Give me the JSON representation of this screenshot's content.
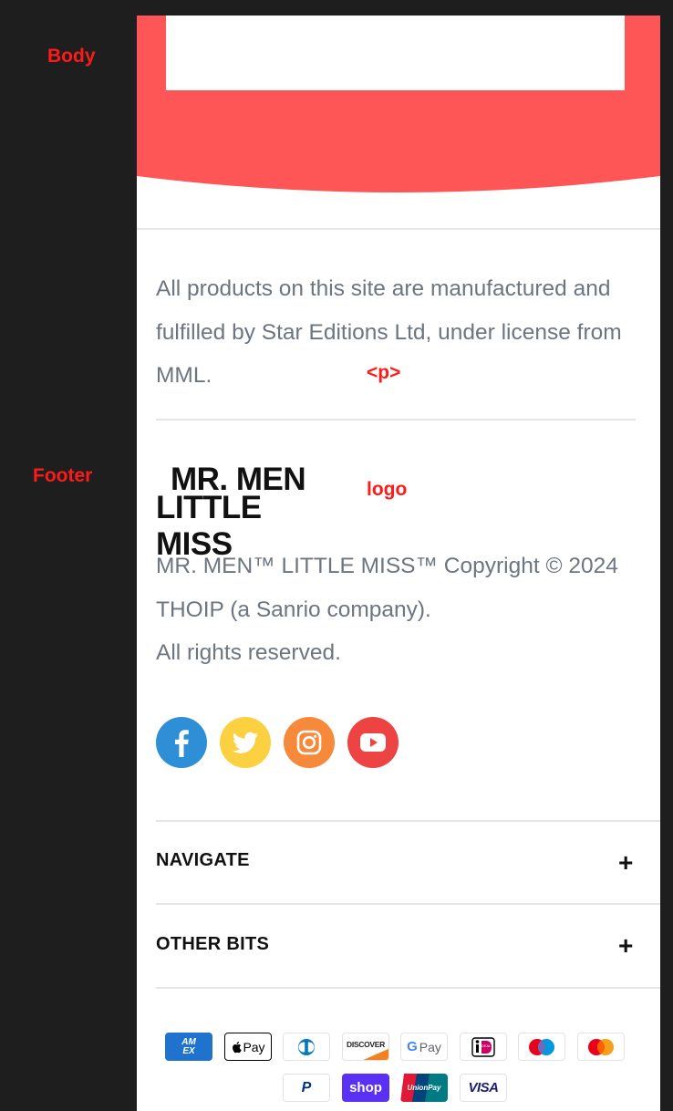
{
  "annotations": {
    "body": "Body",
    "footer": "Footer",
    "p_tag": "<p>",
    "logo": "logo"
  },
  "license_text": "All products on this site are manufactured and fulfilled by Star Editions Ltd, under license from MML.",
  "logo": {
    "line1": "MR. MEN",
    "line2": "LITTLE MISS"
  },
  "copyright": {
    "line1": "MR. MEN™ LITTLE MISS™ Copyright © 2024",
    "line2": "THOIP (a Sanrio company).",
    "line3": "All rights reserved."
  },
  "socials": [
    {
      "name": "facebook-icon",
      "color": "#2e8fd6"
    },
    {
      "name": "twitter-icon",
      "color": "#fbd141"
    },
    {
      "name": "instagram-icon",
      "color": "#f7893a"
    },
    {
      "name": "youtube-icon",
      "color": "#ee4343"
    }
  ],
  "accordion": [
    {
      "title": "NAVIGATE",
      "icon": "+"
    },
    {
      "title": "OTHER BITS",
      "icon": "+"
    }
  ],
  "payments": {
    "amex": "AM EX",
    "apple_pay": "Pay",
    "diners": "diners-club-icon",
    "discover": "DISCOVER",
    "google_pay": "Pay",
    "ideal": "iDEAL",
    "maestro": "maestro-icon",
    "mastercard": "mastercard-icon",
    "paypal": "P",
    "shop_pay": "shop",
    "unionpay": "UnionPay",
    "visa": "VISA"
  },
  "colors": {
    "hero": "#fe5656",
    "text_muted": "#6c7580",
    "annotation": "#ff1a1a"
  }
}
